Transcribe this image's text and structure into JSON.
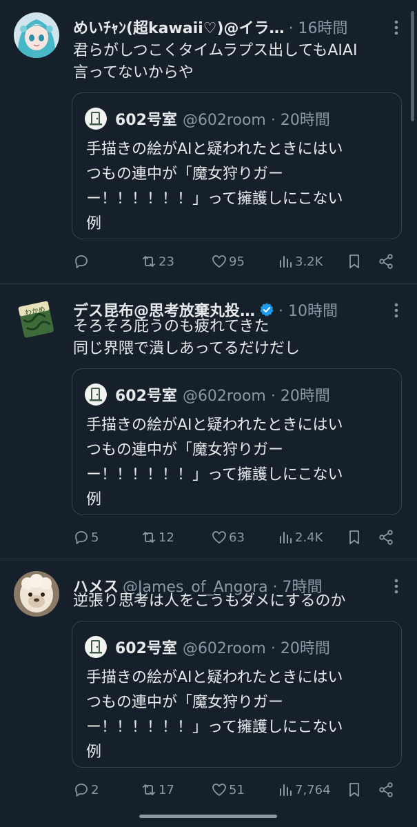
{
  "tweets": [
    {
      "name": "めいﾁｬﾝ(超kawaii♡)@イラ…",
      "meta": "· 16時間",
      "verified": false,
      "text": "君らがしつこくタイムラプス出してもAIAI\n言ってないからや",
      "quote": {
        "name": "602号室",
        "meta": "@602room · 20時間",
        "text": "手描きの絵がAIと疑われたときにはい\nつもの連中が「魔女狩りガー\nー！！！！！！」って擁護しにこない\n例"
      },
      "replies": "",
      "retweets": "23",
      "likes": "95",
      "views": "3.2K"
    },
    {
      "name": "デス昆布@思考放棄丸投…",
      "meta": "· 10時間",
      "verified": true,
      "text": "そろそろ庇うのも疲れてきた\n同じ界隈で潰しあってるだけだし",
      "quote": {
        "name": "602号室",
        "meta": "@602room · 20時間",
        "text": "手描きの絵がAIと疑われたときにはい\nつもの連中が「魔女狩りガー\nー！！！！！！」って擁護しにこない\n例"
      },
      "replies": "5",
      "retweets": "12",
      "likes": "63",
      "views": "2.4K"
    },
    {
      "name": "ハメス",
      "meta": "@James_of_Angora · 7時間",
      "verified": false,
      "text": "逆張り思考は人をこうもダメにするのか",
      "quote": {
        "name": "602号室",
        "meta": "@602room · 20時間",
        "text": "手描きの絵がAIと疑われたときにはい\nつもの連中が「魔女狩りガー\nー！！！！！！」って擁護しにこない\n例"
      },
      "replies": "2",
      "retweets": "17",
      "likes": "51",
      "views": "7,764"
    }
  ],
  "avatar_labels": {
    "wakame": "わかめ"
  },
  "colors": {
    "background": "#15202b",
    "text": "#e7e9ea",
    "muted": "#8b98a5",
    "border": "#38444d",
    "verified": "#1d9bf0"
  }
}
